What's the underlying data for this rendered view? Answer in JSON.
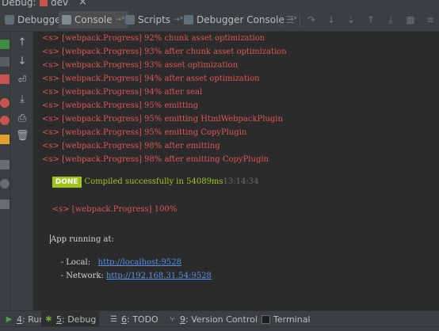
{
  "title_strip": {
    "debug_label": "Debug:",
    "config_name": "dev"
  },
  "tabs": [
    {
      "label": "Debugger",
      "active": false
    },
    {
      "label": "Console",
      "active": true,
      "pin": "→*"
    },
    {
      "label": "Scripts",
      "active": false,
      "pin": "→*"
    },
    {
      "label": "Debugger Console",
      "active": false,
      "pin": "→*"
    }
  ],
  "console": {
    "progress_lines": [
      {
        "prefix": "<s>",
        "text": "[webpack.Progress] 92% chunk asset optimization"
      },
      {
        "prefix": "<s>",
        "text": "[webpack.Progress] 93% after chunk asset optimization"
      },
      {
        "prefix": "<s>",
        "text": "[webpack.Progress] 93% asset optimization"
      },
      {
        "prefix": "<s>",
        "text": "[webpack.Progress] 94% after asset optimization"
      },
      {
        "prefix": "<s>",
        "text": "[webpack.Progress] 94% after seal"
      },
      {
        "prefix": "<s>",
        "text": "[webpack.Progress] 95% emitting"
      },
      {
        "prefix": "<s>",
        "text": "[webpack.Progress] 95% emitting HtmlWebpackPlugin"
      },
      {
        "prefix": "<s>",
        "text": "[webpack.Progress] 95% emitting CopyPlugin"
      },
      {
        "prefix": "<s>",
        "text": "[webpack.Progress] 98% after emitting"
      },
      {
        "prefix": "<s>",
        "text": "[webpack.Progress] 98% after emitting CopyPlugin"
      }
    ],
    "done_badge": "DONE",
    "done_message": "Compiled successfully in 54089ms",
    "done_time": "13:14:34",
    "final_progress": {
      "prefix": "<s>",
      "text": "[webpack.Progress] 100%"
    },
    "app_running": "App running at:",
    "local_label": "- Local:",
    "local_url": "http://localhost:9528",
    "network_label": "- Network:",
    "network_url": "http://192.168.31.54:9528"
  },
  "bottom_tabs": {
    "run": {
      "number": "4",
      "label": "Run"
    },
    "debug": {
      "number": "5",
      "label": "Debug"
    },
    "todo": {
      "number": "6",
      "label": "TODO"
    },
    "vcs": {
      "number": "9",
      "label": "Version Control"
    },
    "terminal": {
      "label": "Terminal"
    }
  },
  "colors": {
    "error_text": "#e05555",
    "done_green": "#a0c41c",
    "link_blue": "#5394ec",
    "background": "#2b2b2b"
  },
  "icons": [
    "up-arrow-icon",
    "down-arrow-icon",
    "soft-wrap-icon",
    "scroll-to-end-icon",
    "print-icon",
    "trash-icon"
  ]
}
